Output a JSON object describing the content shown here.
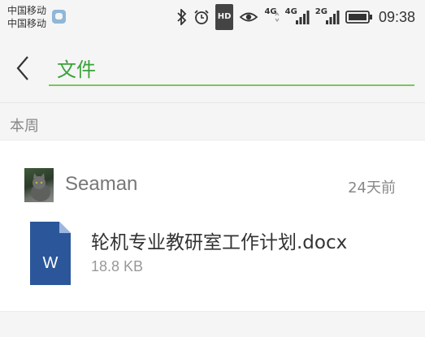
{
  "status_bar": {
    "carrier_1": "中国移动",
    "carrier_2": "中国移动",
    "signal_1_label": "4G",
    "signal_2_label": "4G",
    "signal_3_label": "2G",
    "hd_label": "HD",
    "time": "09:38",
    "icons": [
      "bluetooth-icon",
      "alarm-icon",
      "hd-icon",
      "eye-icon",
      "signal-icon",
      "battery-icon"
    ]
  },
  "header": {
    "title": "文件",
    "accent_color": "#7cc45e"
  },
  "section": {
    "label": "本周"
  },
  "item": {
    "sender": "Seaman",
    "time": "24天前",
    "file_name": "轮机专业教研室工作计划.docx",
    "file_size": "18.8 KB",
    "file_icon_letter": "W",
    "file_icon_color": "#2b579a"
  }
}
